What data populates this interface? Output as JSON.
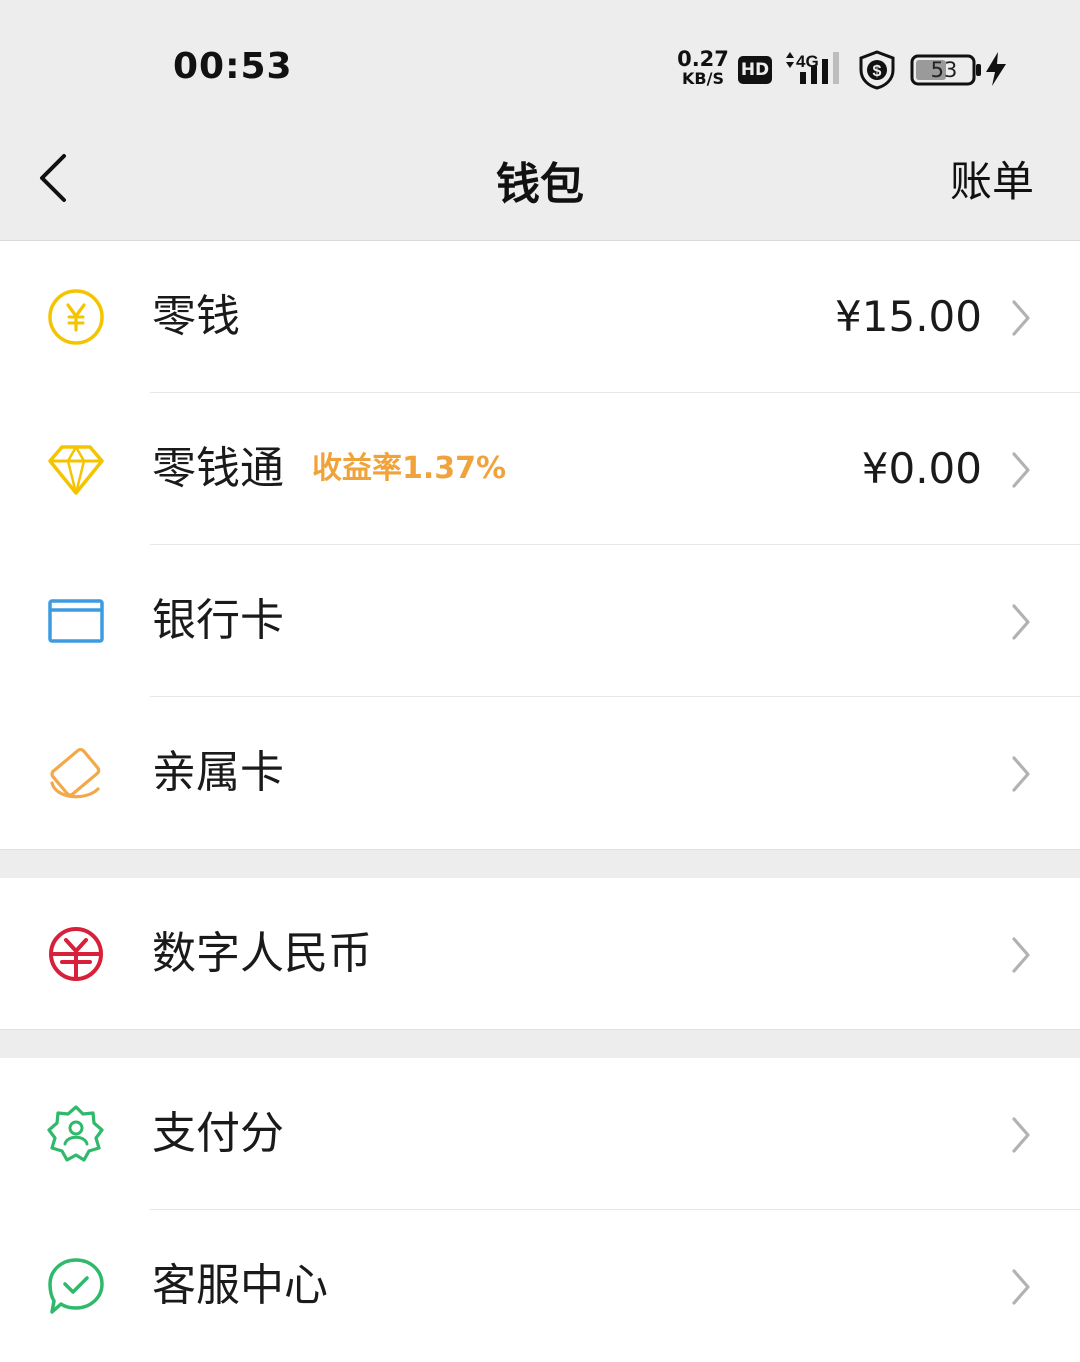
{
  "status_bar": {
    "time": "00:53",
    "net_speed_value": "0.27",
    "net_speed_unit": "KB/S",
    "hd_badge": "HD",
    "network_type": "4G",
    "battery_level": "53"
  },
  "nav": {
    "title": "钱包",
    "right_action": "账单"
  },
  "colors": {
    "background_gray": "#ededed",
    "change_yellow": "#f5c400",
    "gold_orange": "#f0a33b",
    "bank_blue": "#3d9ce0",
    "family_orange": "#f3a84a",
    "rmb_red": "#d8203a",
    "pay_green": "#2fb96b"
  },
  "list": {
    "change": {
      "label": "零钱",
      "value": "¥15.00",
      "icon": "yen-coin-icon"
    },
    "licaitong": {
      "label": "零钱通",
      "tag": "收益率1.37%",
      "value": "¥0.00",
      "icon": "diamond-icon"
    },
    "bank_card": {
      "label": "银行卡",
      "icon": "bank-card-icon"
    },
    "family_card": {
      "label": "亲属卡",
      "icon": "family-card-icon"
    },
    "digital_rmb": {
      "label": "数字人民币",
      "icon": "digital-rmb-icon"
    },
    "pay_score": {
      "label": "支付分",
      "icon": "pay-score-icon"
    },
    "customer_service": {
      "label": "客服中心",
      "icon": "customer-service-icon"
    }
  }
}
